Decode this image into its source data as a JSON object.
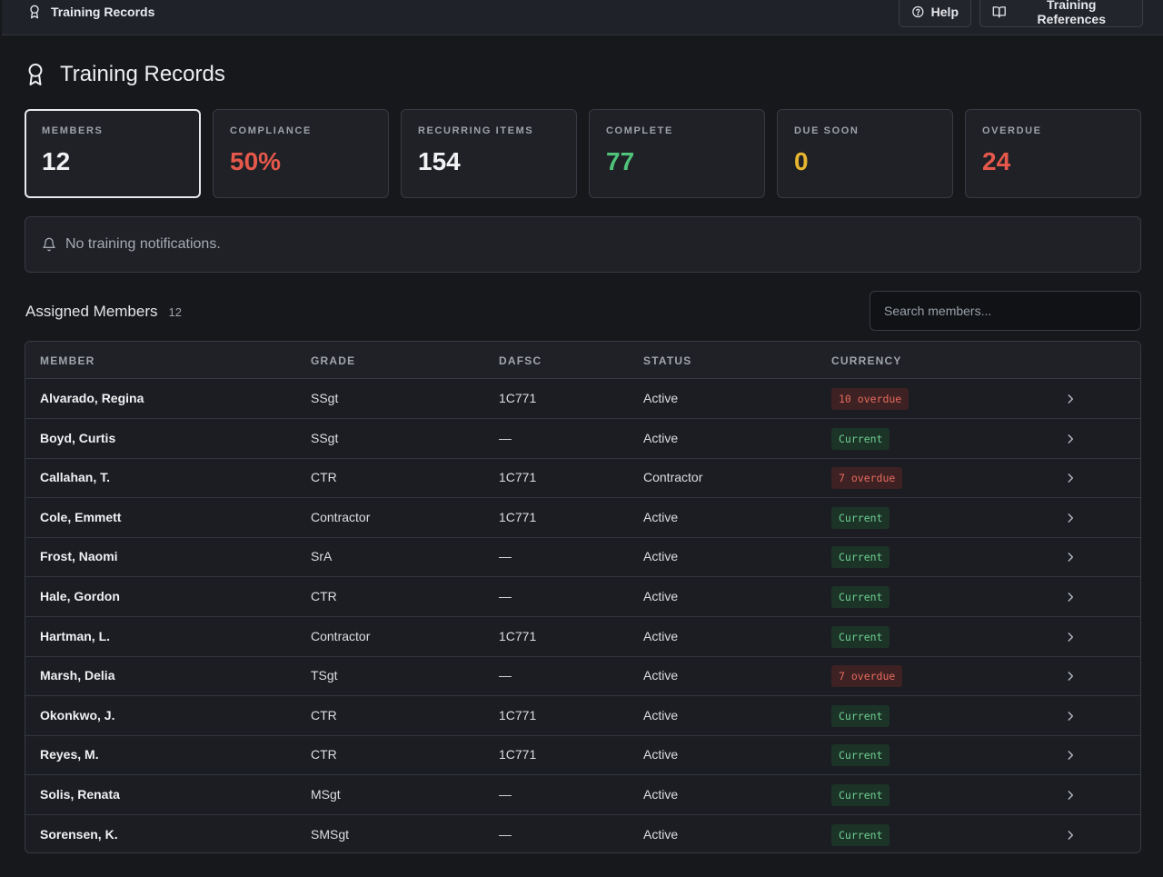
{
  "topbar": {
    "title": "Training Records",
    "help_label": "Help",
    "references_label": "Training References"
  },
  "page": {
    "title": "Training Records"
  },
  "stats": [
    {
      "label": "Members",
      "value": "12",
      "color": "#f1f2f4",
      "selected": true
    },
    {
      "label": "Compliance",
      "value": "50%",
      "color": "#e5584b",
      "selected": false
    },
    {
      "label": "Recurring Items",
      "value": "154",
      "color": "#f1f2f4",
      "selected": false
    },
    {
      "label": "Complete",
      "value": "77",
      "color": "#4fc37a",
      "selected": false
    },
    {
      "label": "Due Soon",
      "value": "0",
      "color": "#e8b530",
      "selected": false
    },
    {
      "label": "Overdue",
      "value": "24",
      "color": "#e5584b",
      "selected": false
    }
  ],
  "notifications": {
    "text": "No training notifications."
  },
  "assigned": {
    "title": "Assigned Members",
    "count": "12",
    "search_placeholder": "Search members..."
  },
  "table": {
    "headers": [
      "Member",
      "Grade",
      "DAFSC",
      "Status",
      "Currency"
    ],
    "rows": [
      {
        "member": "Alvarado, Regina",
        "grade": "SSgt",
        "dafsc": "1C771",
        "status": "Active",
        "currency": "10 overdue",
        "kind": "over"
      },
      {
        "member": "Boyd, Curtis",
        "grade": "SSgt",
        "dafsc": "—",
        "status": "Active",
        "currency": "Current",
        "kind": "curr"
      },
      {
        "member": "Callahan, T.",
        "grade": "CTR",
        "dafsc": "1C771",
        "status": "Contractor",
        "currency": "7 overdue",
        "kind": "over"
      },
      {
        "member": "Cole, Emmett",
        "grade": "Contractor",
        "dafsc": "1C771",
        "status": "Active",
        "currency": "Current",
        "kind": "curr"
      },
      {
        "member": "Frost, Naomi",
        "grade": "SrA",
        "dafsc": "—",
        "status": "Active",
        "currency": "Current",
        "kind": "curr"
      },
      {
        "member": "Hale, Gordon",
        "grade": "CTR",
        "dafsc": "—",
        "status": "Active",
        "currency": "Current",
        "kind": "curr"
      },
      {
        "member": "Hartman, L.",
        "grade": "Contractor",
        "dafsc": "1C771",
        "status": "Active",
        "currency": "Current",
        "kind": "curr"
      },
      {
        "member": "Marsh, Delia",
        "grade": "TSgt",
        "dafsc": "—",
        "status": "Active",
        "currency": "7 overdue",
        "kind": "over"
      },
      {
        "member": "Okonkwo, J.",
        "grade": "CTR",
        "dafsc": "1C771",
        "status": "Active",
        "currency": "Current",
        "kind": "curr"
      },
      {
        "member": "Reyes, M.",
        "grade": "CTR",
        "dafsc": "1C771",
        "status": "Active",
        "currency": "Current",
        "kind": "curr"
      },
      {
        "member": "Solis, Renata",
        "grade": "MSgt",
        "dafsc": "—",
        "status": "Active",
        "currency": "Current",
        "kind": "curr"
      },
      {
        "member": "Sorensen, K.",
        "grade": "SMSgt",
        "dafsc": "—",
        "status": "Active",
        "currency": "Current",
        "kind": "curr"
      }
    ]
  },
  "icons": {
    "brand": "award-icon",
    "help": "help-circle-icon",
    "references": "book-open-icon",
    "notifications": "bell-icon",
    "row_action": "chevron-right-icon"
  }
}
